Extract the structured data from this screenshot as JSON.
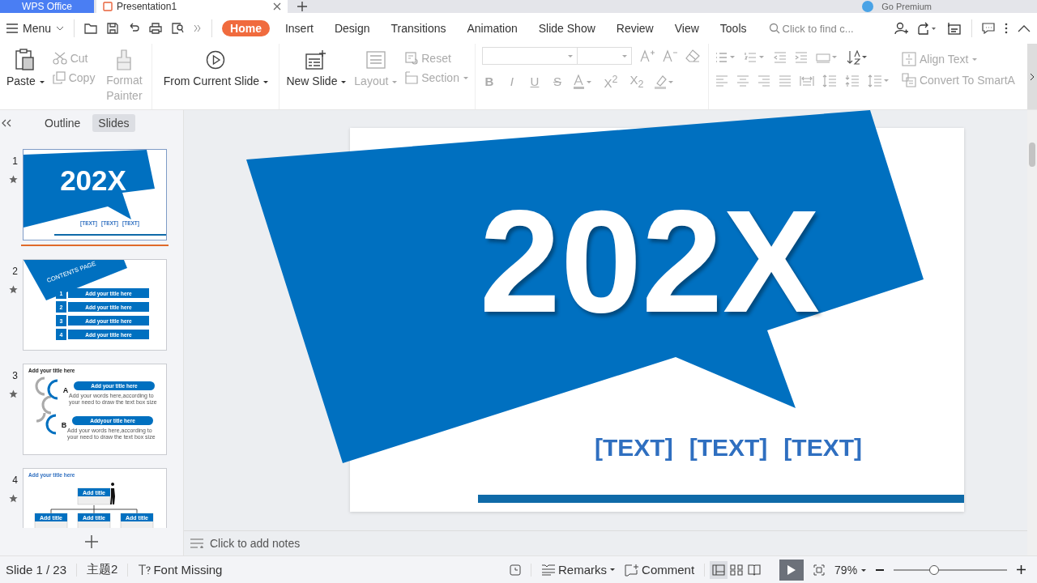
{
  "title_tabs": [
    {
      "label": "WPS Office",
      "selected": false
    },
    {
      "label": "Presentation1",
      "selected": true
    }
  ],
  "account": {
    "label": "Go Premium"
  },
  "menu": {
    "label": "Menu"
  },
  "ribbon_tabs": [
    {
      "label": "Home",
      "selected": true
    },
    {
      "label": "Insert",
      "selected": false
    },
    {
      "label": "Design",
      "selected": false
    },
    {
      "label": "Transitions",
      "selected": false
    },
    {
      "label": "Animation",
      "selected": false
    },
    {
      "label": "Slide Show",
      "selected": false
    },
    {
      "label": "Review",
      "selected": false
    },
    {
      "label": "View",
      "selected": false
    },
    {
      "label": "Tools",
      "selected": false
    }
  ],
  "search": {
    "placeholder": "Click to find c..."
  },
  "ribbon": {
    "paste": {
      "label": "Paste",
      "disabled": false
    },
    "cut": {
      "label": "Cut",
      "disabled": true
    },
    "copy": {
      "label": "Copy",
      "disabled": true
    },
    "format_painter": {
      "label": "Format Painter",
      "disabled": true
    },
    "from_current_slide": {
      "label": "From Current Slide",
      "disabled": false
    },
    "new_slide": {
      "label": "New Slide",
      "disabled": false
    },
    "layout": {
      "label": "Layout",
      "disabled": true
    },
    "reset": {
      "label": "Reset",
      "disabled": true
    },
    "section": {
      "label": "Section",
      "disabled": true
    },
    "font_styles": [
      {
        "kind": "bold",
        "label": "B"
      },
      {
        "kind": "italic",
        "label": "I"
      },
      {
        "kind": "underline",
        "label": "U"
      },
      {
        "kind": "strike",
        "label": "S"
      }
    ],
    "superscript": "X$^{2}$",
    "subscript": "X$_{2}$",
    "align_text": {
      "label": "Align Text",
      "disabled": true
    },
    "convert_smartart": {
      "label": "Convert To SmartA",
      "disabled": true
    }
  },
  "slides_panel": {
    "tabs": [
      {
        "label": "Outline",
        "selected": false
      },
      {
        "label": "Slides",
        "selected": true
      }
    ],
    "slides": [
      {
        "number": "1",
        "kind": "cover",
        "selected": true,
        "title": "202X",
        "texts": [
          "[TEXT]",
          "[TEXT]",
          "[TEXT]"
        ]
      },
      {
        "number": "2",
        "kind": "contents",
        "selected": false,
        "heading": "CONTENTS PAGE",
        "items": [
          {
            "number": "1",
            "title": "Add your title here"
          },
          {
            "number": "2",
            "title": "Add your title here"
          },
          {
            "number": "3",
            "title": "Add your title here"
          },
          {
            "number": "4",
            "title": "Add your title here"
          }
        ]
      },
      {
        "number": "3",
        "kind": "steps",
        "selected": false,
        "title": "Add your title here",
        "steps": [
          {
            "letter": "A",
            "title": "Add your title here",
            "lines": [
              "Add your words here,according to",
              "your need to draw the text box size"
            ]
          },
          {
            "letter": "B",
            "title": "Addyour title here",
            "lines": [
              "Add your words here,according to",
              "your need to draw the text box size"
            ]
          }
        ]
      },
      {
        "number": "4",
        "kind": "org",
        "selected": false,
        "title": "Add your title here",
        "boxes": [
          "Add title",
          "Add title",
          "Add title",
          "Add title"
        ]
      }
    ]
  },
  "slide": {
    "title": "202X",
    "texts": [
      "[TEXT]",
      "[TEXT]",
      "[TEXT]"
    ]
  },
  "notes": {
    "placeholder": "Click to add notes"
  },
  "status_bar": {
    "slide": "Slide 1 / 23",
    "theme": "主题2",
    "font_missing": "Font Missing",
    "remarks": "Remarks",
    "comment": "Comment",
    "views": [
      {
        "selected": true
      },
      {
        "selected": false
      },
      {
        "selected": false
      }
    ],
    "zoom": "79%",
    "zoom_slider": {
      "level": 0.36
    }
  }
}
